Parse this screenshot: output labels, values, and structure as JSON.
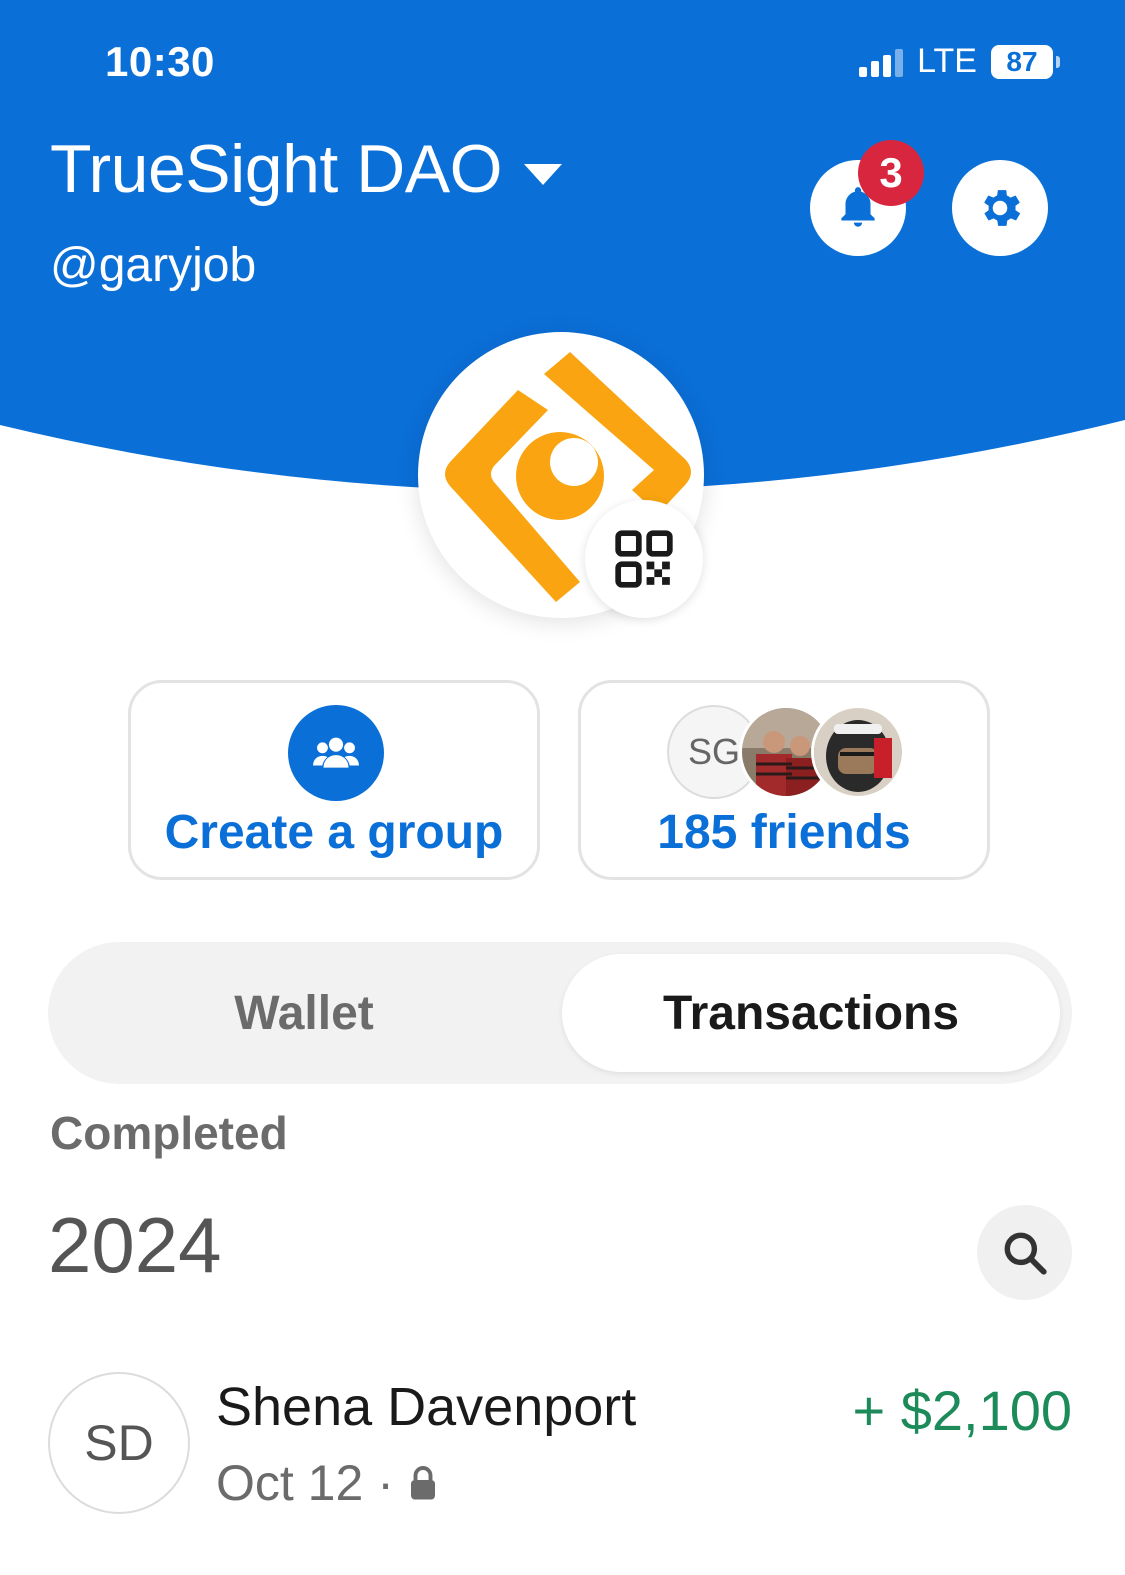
{
  "status_bar": {
    "time": "10:30",
    "network": "LTE",
    "battery": "87"
  },
  "header": {
    "title": "TrueSight DAO",
    "handle": "@garyjob",
    "notification_count": "3",
    "brand_color": "#0b6fd8"
  },
  "actions": {
    "create_group_label": "Create a group",
    "friends_label": "185 friends",
    "friend_initials": "SG"
  },
  "tabs": [
    {
      "label": "Wallet",
      "selected": false
    },
    {
      "label": "Transactions",
      "selected": true
    }
  ],
  "transactions": {
    "section_label": "Completed",
    "year": "2024",
    "items": [
      {
        "initials": "SD",
        "name": "Shena Davenport",
        "date": "Oct 12",
        "separator": "·",
        "amount": "+ $2,100",
        "amount_color": "#1d8a5a"
      }
    ]
  },
  "icons": [
    "signal-icon",
    "battery-icon",
    "dropdown-caret-icon",
    "bell-icon",
    "gear-icon",
    "qr-code-icon",
    "group-icon",
    "search-icon",
    "lock-icon"
  ]
}
